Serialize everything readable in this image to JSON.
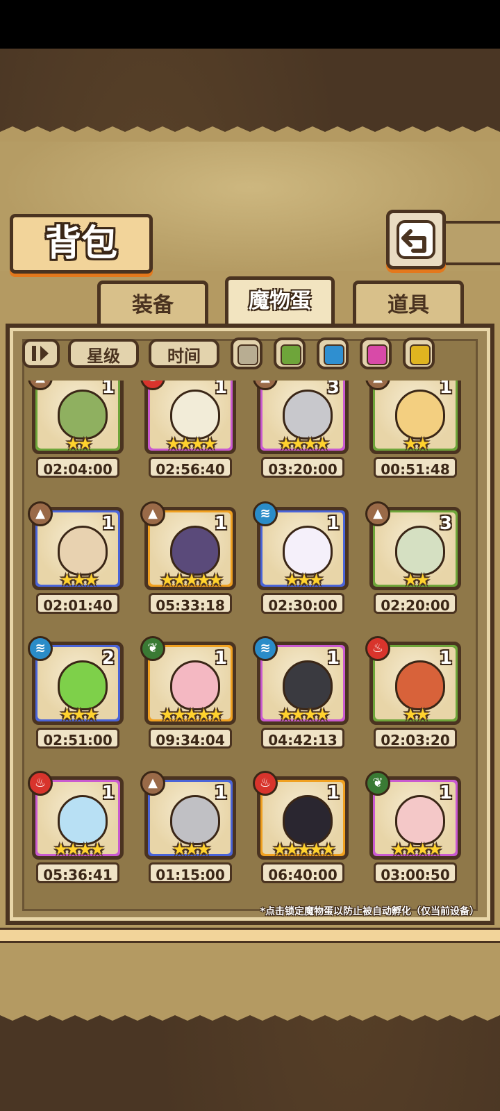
{
  "header": {
    "title": "背包"
  },
  "tabs": [
    {
      "label": "装备",
      "active": false
    },
    {
      "label": "魔物蛋",
      "active": true
    },
    {
      "label": "道具",
      "active": false
    }
  ],
  "filters": {
    "sort_icon": "sort-toggle-icon",
    "star_label": "星级",
    "time_label": "时间",
    "colors": [
      "#b8ad92",
      "#6ea53a",
      "#2f8fd0",
      "#d84aa8",
      "#e0b420"
    ]
  },
  "element_colors": {
    "earth": "#9a6a48",
    "fire": "#d8342c",
    "water": "#2a8cc8",
    "nature": "#3a7a34"
  },
  "rarity_colors": {
    "green": "#6ea53a",
    "purple": "#c95ad0",
    "blue": "#4a64d8",
    "orange": "#f0a020"
  },
  "eggs": [
    {
      "element": "earth",
      "rarity": "green",
      "count": "1",
      "stars": "★★",
      "time": "02:04:00",
      "art": "#8fb060"
    },
    {
      "element": "fire",
      "rarity": "purple",
      "count": "1",
      "stars": "★★★★",
      "time": "02:56:40",
      "art": "#f2ecd8"
    },
    {
      "element": "earth",
      "rarity": "purple",
      "count": "3",
      "stars": "★★★★",
      "time": "03:20:00",
      "art": "#c8c8cc"
    },
    {
      "element": "earth",
      "rarity": "green",
      "count": "1",
      "stars": "★★",
      "time": "00:51:48",
      "art": "#f3cf80"
    },
    {
      "element": "earth",
      "rarity": "blue",
      "count": "1",
      "stars": "★★★",
      "time": "02:01:40",
      "art": "#e8d2b0"
    },
    {
      "element": "earth",
      "rarity": "orange",
      "count": "1",
      "stars": "★★★★★",
      "time": "05:33:18",
      "art": "#5a4a7a"
    },
    {
      "element": "water",
      "rarity": "blue",
      "count": "1",
      "stars": "★★★",
      "time": "02:30:00",
      "art": "#f5f0fa"
    },
    {
      "element": "earth",
      "rarity": "green",
      "count": "3",
      "stars": "★★",
      "time": "02:20:00",
      "art": "#d5e0c2"
    },
    {
      "element": "water",
      "rarity": "blue",
      "count": "2",
      "stars": "★★★",
      "time": "02:51:00",
      "art": "#7ed04a"
    },
    {
      "element": "nature",
      "rarity": "orange",
      "count": "1",
      "stars": "★★★★★",
      "time": "09:34:04",
      "art": "#f4b8c2"
    },
    {
      "element": "water",
      "rarity": "purple",
      "count": "1",
      "stars": "★★★★",
      "time": "04:42:13",
      "art": "#3a3a40"
    },
    {
      "element": "fire",
      "rarity": "green",
      "count": "1",
      "stars": "★★",
      "time": "02:03:20",
      "art": "#d8623a"
    },
    {
      "element": "fire",
      "rarity": "purple",
      "count": "1",
      "stars": "★★★★",
      "time": "05:36:41",
      "art": "#b8e0f4"
    },
    {
      "element": "earth",
      "rarity": "blue",
      "count": "1",
      "stars": "★★★",
      "time": "01:15:00",
      "art": "#c0c0c4"
    },
    {
      "element": "fire",
      "rarity": "orange",
      "count": "1",
      "stars": "★★★★★",
      "time": "06:40:00",
      "art": "#2a2630"
    },
    {
      "element": "nature",
      "rarity": "purple",
      "count": "1",
      "stars": "★★★★",
      "time": "03:00:50",
      "art": "#f4c8c8"
    }
  ],
  "hint": "*点击锁定魔物蛋以防止被自动孵化（仅当前设备）"
}
